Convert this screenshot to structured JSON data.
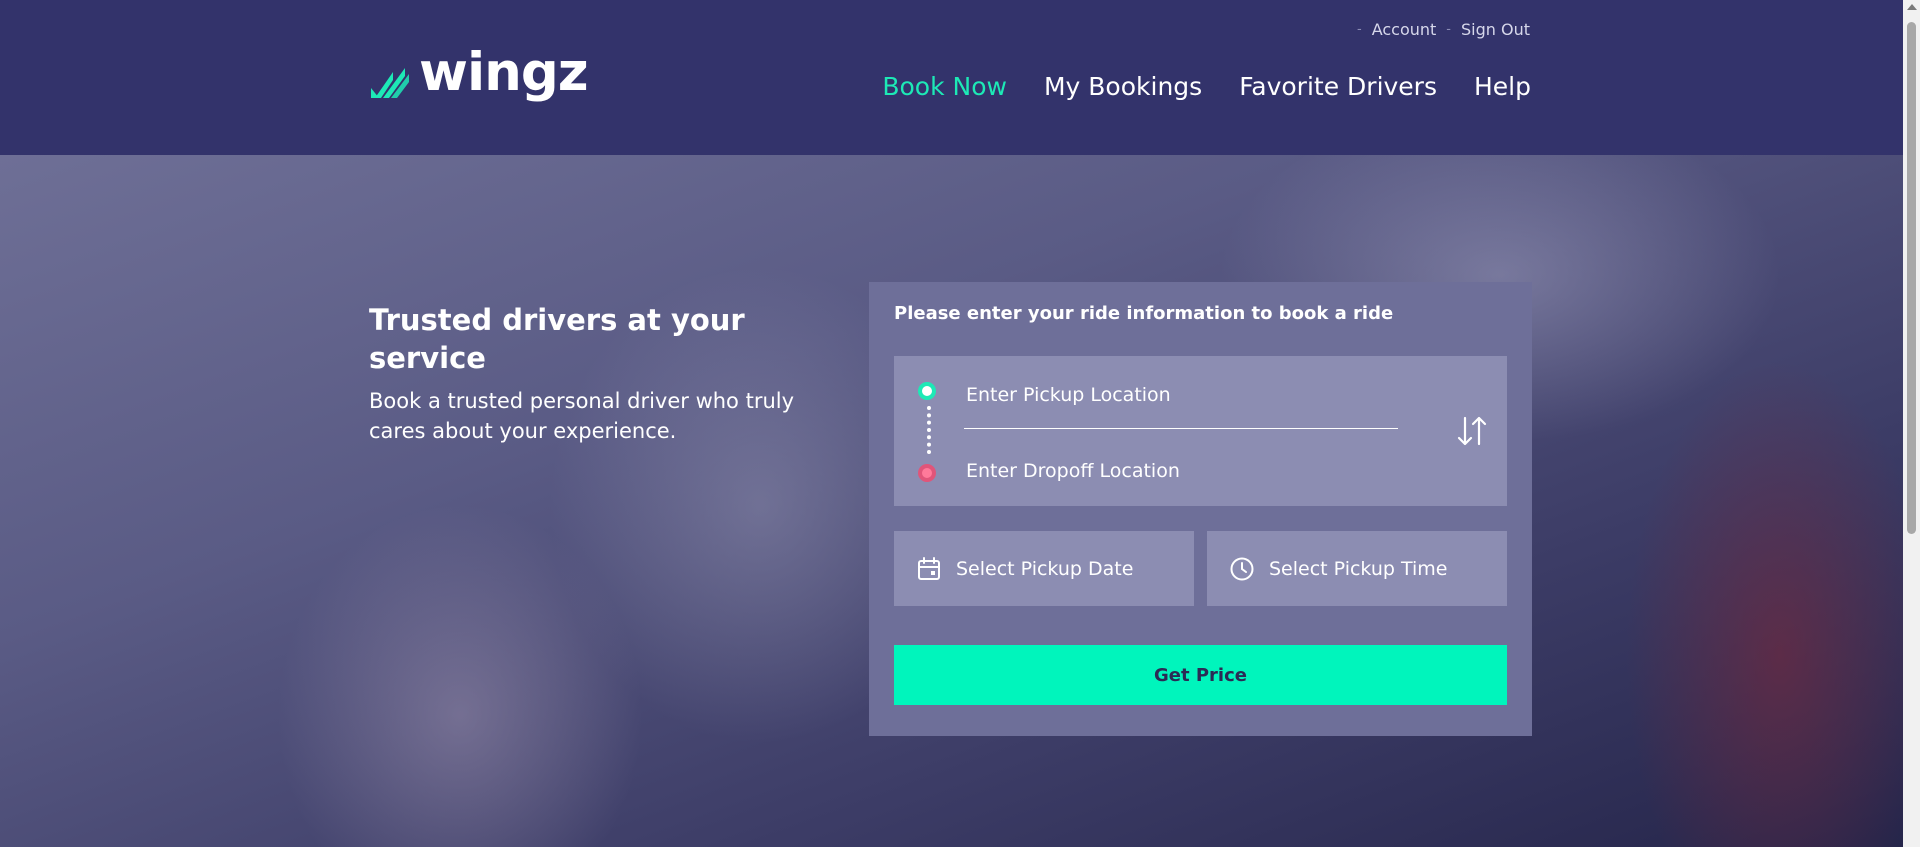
{
  "header": {
    "logo_text": "wingz",
    "top_links": [
      {
        "label": "Account"
      },
      {
        "label": "Sign Out"
      }
    ],
    "nav": [
      {
        "label": "Book Now",
        "active": true
      },
      {
        "label": "My Bookings",
        "active": false
      },
      {
        "label": "Favorite Drivers",
        "active": false
      },
      {
        "label": "Help",
        "active": false
      }
    ]
  },
  "hero": {
    "title": "Trusted drivers at your service",
    "subtitle": "Book a trusted personal driver who truly cares about your experience."
  },
  "booking": {
    "title": "Please enter your ride information to book a ride",
    "pickup_placeholder": "Enter Pickup Location",
    "dropoff_placeholder": "Enter Dropoff Location",
    "date_label": "Select Pickup Date",
    "time_label": "Select Pickup Time",
    "submit_label": "Get Price"
  },
  "colors": {
    "header_bg": "#33336b",
    "accent": "#1de9b6",
    "button": "#00f5bc",
    "dropoff_dot": "#e0557a"
  },
  "icons": {
    "logo": "wingz-logo-icon",
    "swap": "swap-arrows-icon",
    "date": "calendar-icon",
    "time": "clock-icon"
  }
}
